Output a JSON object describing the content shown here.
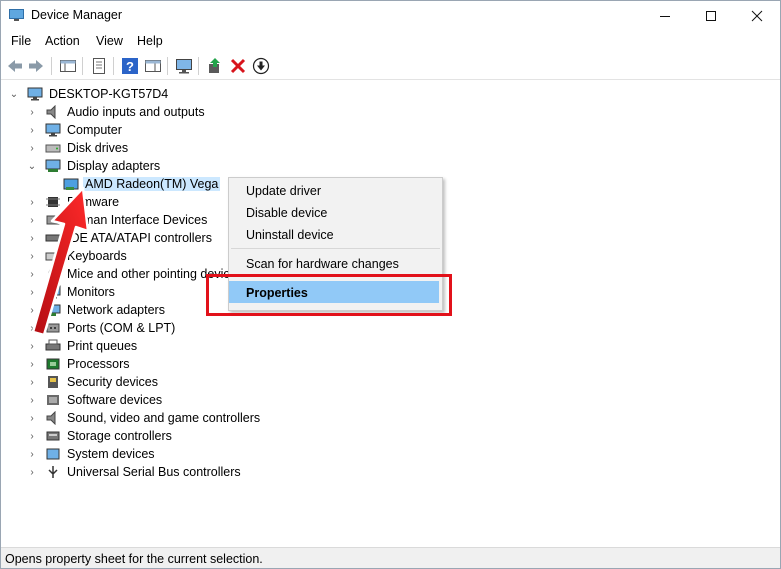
{
  "window": {
    "title": "Device Manager",
    "controls": [
      "minimize",
      "maximize",
      "close"
    ]
  },
  "menubar": [
    "File",
    "Action",
    "View",
    "Help"
  ],
  "toolbar": {
    "buttons": [
      "back-icon",
      "forward-icon",
      "console-tree-icon",
      "properties-sheet-icon",
      "help-icon",
      "action-pane-icon",
      "scan-monitor-icon",
      "update-driver-icon",
      "uninstall-x-icon",
      "disable-down-icon"
    ]
  },
  "tree": {
    "root": "DESKTOP-KGT57D4",
    "items": [
      {
        "label": "Audio inputs and outputs",
        "icon": "speaker-icon"
      },
      {
        "label": "Computer",
        "icon": "monitor-icon"
      },
      {
        "label": "Disk drives",
        "icon": "disk-icon"
      },
      {
        "label": "Display adapters",
        "icon": "display-adapter-icon",
        "expanded": true
      },
      {
        "label": "AMD Radeon(TM) Vega",
        "icon": "gpu-icon",
        "child": true,
        "selected": true
      },
      {
        "label": "Firmware",
        "icon": "chip-icon"
      },
      {
        "label": "Human Interface Devices",
        "icon": "hid-icon"
      },
      {
        "label": "IDE ATA/ATAPI controllers",
        "icon": "ide-icon"
      },
      {
        "label": "Keyboards",
        "icon": "keyboard-icon"
      },
      {
        "label": "Mice and other pointing devices",
        "icon": "mouse-icon"
      },
      {
        "label": "Monitors",
        "icon": "monitor-icon"
      },
      {
        "label": "Network adapters",
        "icon": "network-icon"
      },
      {
        "label": "Ports (COM & LPT)",
        "icon": "port-icon"
      },
      {
        "label": "Print queues",
        "icon": "printer-icon"
      },
      {
        "label": "Processors",
        "icon": "cpu-icon"
      },
      {
        "label": "Security devices",
        "icon": "security-icon"
      },
      {
        "label": "Software devices",
        "icon": "software-icon"
      },
      {
        "label": "Sound, video and game controllers",
        "icon": "speaker-icon"
      },
      {
        "label": "Storage controllers",
        "icon": "storage-icon"
      },
      {
        "label": "System devices",
        "icon": "system-icon"
      },
      {
        "label": "Universal Serial Bus controllers",
        "icon": "usb-icon"
      }
    ]
  },
  "context_menu": {
    "items": [
      "Update driver",
      "Disable device",
      "Uninstall device",
      "Scan for hardware changes",
      "Properties"
    ],
    "highlighted": "Properties"
  },
  "status": "Opens property sheet for the current selection.",
  "colors": {
    "selection": "#cce8ff",
    "menu_highlight": "#91c9f7",
    "annotation_red": "#e2111a"
  }
}
